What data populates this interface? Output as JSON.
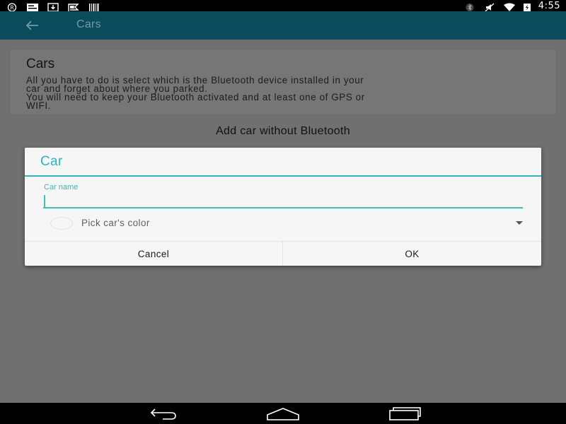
{
  "status_bar": {
    "clock": "4:55",
    "left_icons": [
      "registered-icon",
      "message-icon",
      "download-icon",
      "navigation-flag-icon",
      "barcode-icon"
    ],
    "right_icons": [
      "bluetooth-icon",
      "mute-icon",
      "wifi-icon",
      "battery-charging-icon"
    ]
  },
  "app_bar": {
    "back_icon": "arrow-back-icon",
    "title": "Cars"
  },
  "info_card": {
    "title": "Cars",
    "line1": "All you have to do is select which is the Bluetooth device installed in your",
    "line2": "car and forget about where you parked.",
    "line3": "You will need to keep your Bluetooth activated and at least one of GPS or",
    "line4": "WIFI."
  },
  "add_car_label": "Add car without Bluetooth",
  "dialog": {
    "title": "Car",
    "car_name_label": "Car name",
    "car_name_value": "",
    "color_label": "Pick car's color",
    "cancel_label": "Cancel",
    "ok_label": "OK"
  },
  "nav_bar": {
    "icons": [
      "back-nav-icon",
      "home-nav-icon",
      "recents-nav-icon"
    ]
  },
  "colors": {
    "app_bar": "#0a4b5c",
    "accent": "#2db3cc",
    "input_accent": "#3cc4b4",
    "scrim_background": "#707070"
  }
}
